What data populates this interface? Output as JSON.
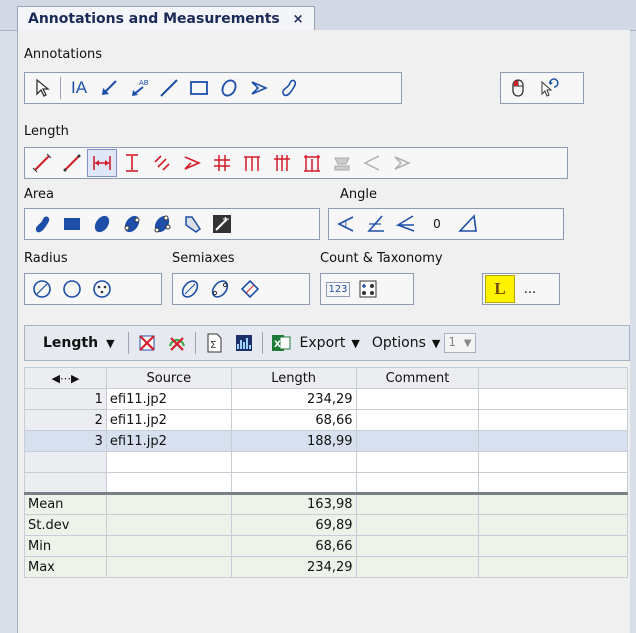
{
  "tab": {
    "title": "Annotations and Measurements",
    "close": "×"
  },
  "sections": {
    "annotations": "Annotations",
    "length": "Length",
    "area": "Area",
    "angle": "Angle",
    "radius": "Radius",
    "semiaxes": "Semiaxes",
    "count": "Count & Taxonomy"
  },
  "annotation_tools": {
    "text_tool": "IA",
    "arrow_text": "AB"
  },
  "angle_value": "0",
  "count_tools": {
    "numbered": "123",
    "taxonomy_label": "L",
    "more": "..."
  },
  "toolbar": {
    "mode": "Length",
    "export": "Export",
    "options": "Options",
    "page": "1"
  },
  "table": {
    "columns": [
      "◀⋯▶",
      "Source",
      "Length",
      "Comment",
      ""
    ],
    "rows": [
      {
        "n": "1",
        "source": "efi11.jp2",
        "length": "234,29",
        "comment": ""
      },
      {
        "n": "2",
        "source": "efi11.jp2",
        "length": "68,66",
        "comment": ""
      },
      {
        "n": "3",
        "source": "efi11.jp2",
        "length": "188,99",
        "comment": ""
      }
    ],
    "stats": [
      {
        "label": "Mean",
        "value": "163,98"
      },
      {
        "label": "St.dev",
        "value": "69,89"
      },
      {
        "label": "Min",
        "value": "68,66"
      },
      {
        "label": "Max",
        "value": "234,29"
      }
    ]
  },
  "colors": {
    "accent": "#1b2a57",
    "icon_blue": "#1d4fa8",
    "icon_red": "#d31d2a",
    "selection": "#d7e0ee"
  }
}
